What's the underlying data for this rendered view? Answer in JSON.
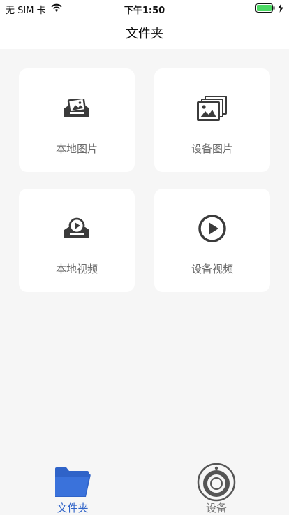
{
  "status_bar": {
    "carrier": "无 SIM 卡",
    "time": "下午1:50",
    "icons": [
      "wifi-icon",
      "battery-icon",
      "charging-bolt-icon"
    ],
    "battery_color": "#4cd964"
  },
  "header": {
    "title": "文件夹"
  },
  "cards": [
    {
      "label": "本地图片",
      "icon": "local-picture-icon"
    },
    {
      "label": "设备图片",
      "icon": "device-pictures-icon"
    },
    {
      "label": "本地视频",
      "icon": "local-video-icon"
    },
    {
      "label": "设备视频",
      "icon": "play-circle-icon"
    }
  ],
  "tab_bar": {
    "tabs": [
      {
        "label": "文件夹",
        "icon": "folder-icon",
        "active": true
      },
      {
        "label": "设备",
        "icon": "device-camera-icon",
        "active": false
      }
    ]
  },
  "colors": {
    "background": "#f6f6f6",
    "card": "#ffffff",
    "icon": "#3b3b3b",
    "active_tab": "#2f63c8",
    "inactive_tab": "#7a7a7a"
  }
}
